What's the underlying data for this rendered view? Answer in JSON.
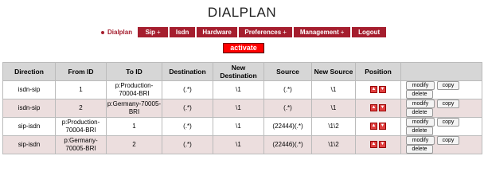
{
  "page": {
    "title": "DIALPLAN"
  },
  "nav": {
    "items": [
      {
        "label": "Dialplan",
        "active": true,
        "arrow": ""
      },
      {
        "label": "Sip",
        "active": false,
        "arrow": "+"
      },
      {
        "label": "Isdn",
        "active": false,
        "arrow": ""
      },
      {
        "label": "Hardware",
        "active": false,
        "arrow": ""
      },
      {
        "label": "Preferences",
        "active": false,
        "arrow": "+"
      },
      {
        "label": "Management",
        "active": false,
        "arrow": "+"
      },
      {
        "label": "Logout",
        "active": false,
        "arrow": ""
      }
    ]
  },
  "activate_label": "activate",
  "table": {
    "headers": [
      "Direction",
      "From ID",
      "To ID",
      "Destination",
      "New Destination",
      "Source",
      "New Source",
      "Position",
      ""
    ],
    "rows": [
      {
        "direction": "isdn-sip",
        "from_id": "1",
        "to_id": "p:Production-70004-BRI",
        "destination": "(.*)",
        "new_destination": "\\1",
        "source": "(.*)",
        "new_source": "\\1"
      },
      {
        "direction": "isdn-sip",
        "from_id": "2",
        "to_id": "p:Germany-70005-BRI",
        "destination": "(.*)",
        "new_destination": "\\1",
        "source": "(.*)",
        "new_source": "\\1"
      },
      {
        "direction": "sip-isdn",
        "from_id": "p:Production-70004-BRI",
        "to_id": "1",
        "destination": "(.*)",
        "new_destination": "\\1",
        "source": "(22444)(.*)",
        "new_source": "\\1\\2"
      },
      {
        "direction": "sip-isdn",
        "from_id": "p:Germany-70005-BRI",
        "to_id": "2",
        "destination": "(.*)",
        "new_destination": "\\1",
        "source": "(22446)(.*)",
        "new_source": "\\1\\2"
      }
    ],
    "actions": {
      "modify": "modify",
      "copy": "copy",
      "delete": "delete"
    },
    "position_icons": {
      "up": "arrow-up-icon",
      "down": "arrow-down-icon"
    }
  },
  "colors": {
    "nav_bg": "#a51e2e",
    "activate_bg": "#ff0000",
    "header_bg": "#d6d6d6",
    "row_alt_bg": "#ecdede"
  }
}
